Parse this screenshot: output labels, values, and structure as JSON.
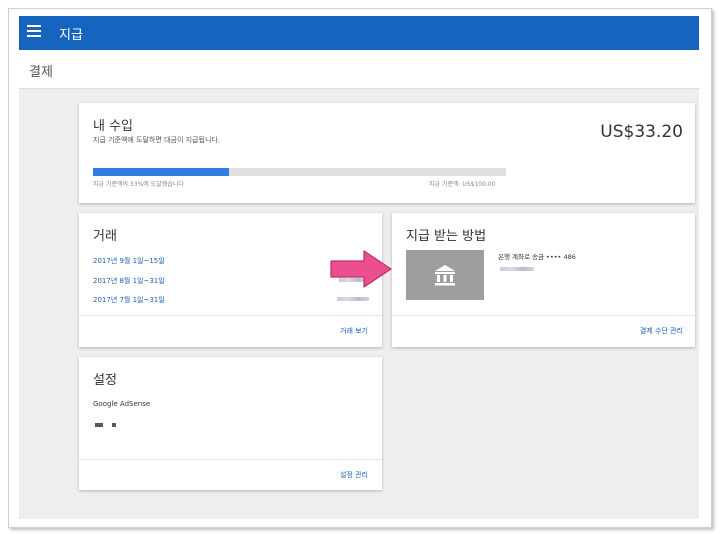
{
  "header": {
    "title": "지급"
  },
  "subheader": {
    "title": "결제"
  },
  "earnings": {
    "title": "내 수입",
    "description": "지급 기준액에 도달하면 대금이 지급됩니다.",
    "amount": "US$33.20",
    "progress_percent": 33,
    "progress_left": "지급 기준액의 33%에 도달했습니다",
    "progress_right": "지급 기준액: US$100.00"
  },
  "transactions": {
    "title": "거래",
    "items": [
      "2017년 9월 1일~15일",
      "2017년 8월 1일~31일",
      "2017년 7월 1일~31일"
    ],
    "action": "거래 보기"
  },
  "payment_method": {
    "title": "지급 받는 방법",
    "account": "은행 계좌로 송금 •••• 486",
    "icon": "bank-icon",
    "action": "결제 수단 관리"
  },
  "settings": {
    "title": "설정",
    "product": "Google AdSense",
    "action": "설정 관리"
  },
  "colors": {
    "topbar": "#1565c0",
    "progress": "#2f7de1",
    "arrow": "#ec4f8d",
    "link": "#1a5fb4"
  }
}
